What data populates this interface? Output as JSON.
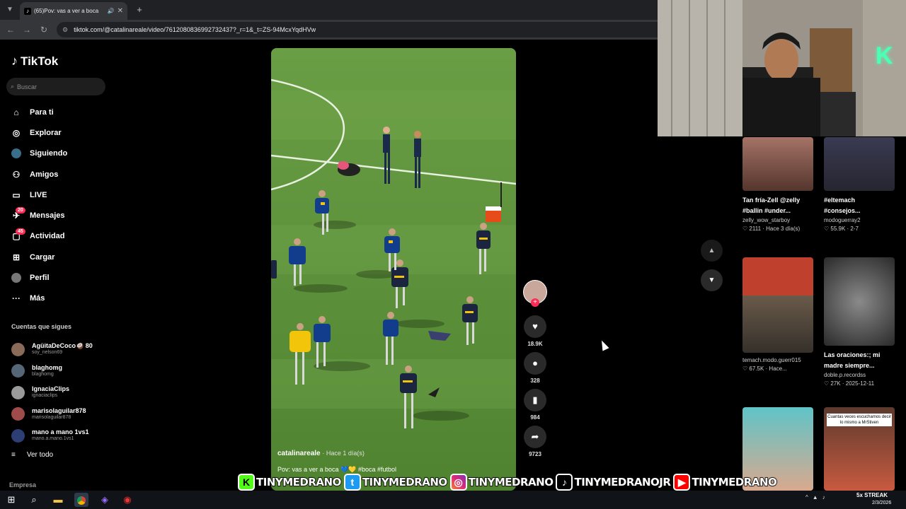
{
  "browser": {
    "tab_title": "(65)Pov: vas a ver a boca",
    "tab_close": "✕",
    "new_tab": "+",
    "url": "tiktok.com/@catalinareale/video/7612080836992732437?_r=1&_t=ZS-94McxYqdHVw"
  },
  "sidebar": {
    "logo": "TikTok",
    "search_placeholder": "Buscar",
    "nav": [
      {
        "label": "Para ti",
        "icon": "home-icon"
      },
      {
        "label": "Explorar",
        "icon": "compass-icon"
      },
      {
        "label": "Siguiendo",
        "icon": "following-icon"
      },
      {
        "label": "Amigos",
        "icon": "friends-icon"
      },
      {
        "label": "LIVE",
        "icon": "live-icon"
      },
      {
        "label": "Mensajes",
        "icon": "messages-icon",
        "badge": "20"
      },
      {
        "label": "Actividad",
        "icon": "activity-icon",
        "badge": "45"
      },
      {
        "label": "Cargar",
        "icon": "upload-icon"
      },
      {
        "label": "Perfil",
        "icon": "profile-icon"
      },
      {
        "label": "Más",
        "icon": "more-icon"
      }
    ],
    "following_title": "Cuentas que sigues",
    "following": [
      {
        "name": "AgüitaDeCoco🥥 80",
        "handle": "soy_nelson69"
      },
      {
        "name": "blaghomg",
        "handle": "blaghomg"
      },
      {
        "name": "IgnaciaClips",
        "handle": "ignaciaclips"
      },
      {
        "name": "marisolaguilar878",
        "handle": "marisolaguilar878"
      },
      {
        "name": "mano a mano 1vs1",
        "handle": "mano.a.mano.1vs1"
      }
    ],
    "see_all": "Ver todo",
    "footer": "Empresa"
  },
  "video": {
    "author": "catalinareale",
    "when": "· Hace 1 día(s)",
    "caption": "Pov: vas a ver a boca 💙💛 #boca #futbol"
  },
  "actions": {
    "likes": "18.9K",
    "comments": "328",
    "saves": "984",
    "shares": "9723"
  },
  "recommendations": [
    {
      "title": "Tan fría-Zell @zelly #ballin #under...",
      "user": "zelly_wow_starboy",
      "meta": "2111 · Hace 3 día(s)"
    },
    {
      "title": "#eltemach #consejos...",
      "user": "modoguerray2",
      "meta": "55.9K · 2-7"
    },
    {
      "title": "",
      "user": "temach.modo.guerr015",
      "meta": "67.5K · Hace..."
    },
    {
      "title": "Las oraciones:; mi madre siempre...",
      "user": "doble.p.recordss",
      "meta": "27K · 2025-12-11"
    },
    {
      "title": "",
      "user": "",
      "meta": ""
    },
    {
      "title": "",
      "user": "",
      "meta": "",
      "thumb_text": "Cuantas veces escuchamos decir lo mismo a MrStiven"
    }
  ],
  "overlay": {
    "socials": [
      "TINYMEDRANO",
      "TINYMEDRANO",
      "TINYMEDRANO",
      "TINYMEDRANOJR",
      "TINYMEDRANO"
    ],
    "streak": "5x STREAK",
    "clock_date": "2/3/2026"
  },
  "colors": {
    "accent": "#fe2c55",
    "field": "#5c8e38",
    "boca_blue": "#123d8c",
    "boca_yellow": "#f2c40a"
  }
}
